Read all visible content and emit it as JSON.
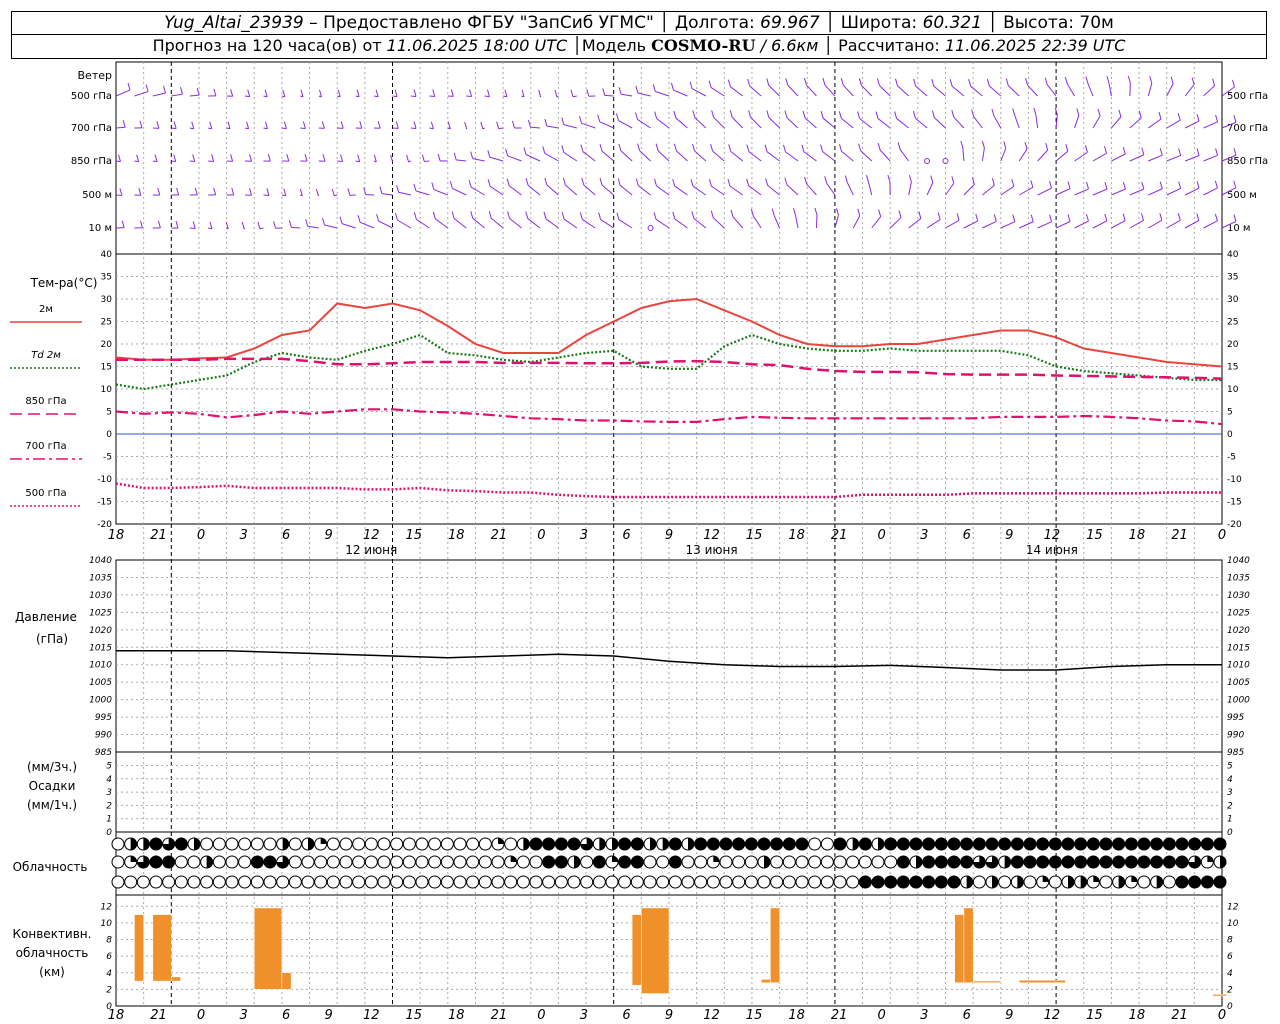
{
  "header": {
    "station": "Yug_Altai_23939",
    "provider": " – Предоставлено ФГБУ \"ЗапСиб УГМС\" ",
    "lon_label": "Долгота:",
    "lon": "69.967",
    "lat_label": "Широта:",
    "lat": "60.321",
    "alt_label": "Высота:",
    "alt": "70м",
    "forecast_label": "Прогноз на 120 часа(ов) от",
    "forecast_from": "11.06.2025 18:00 UTC",
    "model_label": "Модель",
    "model": "COSMO-RU",
    "model_res": " / 6.6км",
    "calc_label": "Рассчитано:",
    "calc_time": "11.06.2025 22:39 UTC"
  },
  "wind": {
    "title": "Ветер",
    "levels": [
      "500 гПа",
      "700 гПа",
      "850 гПа",
      "500 м",
      "10 м"
    ]
  },
  "temperature": {
    "title": "Тем-ра(°С)",
    "legend": [
      {
        "label": "2м",
        "color": "#e8453c",
        "style": "solid"
      },
      {
        "label": "Td  2м",
        "color": "#1a7a1a",
        "style": "dotted"
      },
      {
        "label": "850 гПа",
        "color": "#e0106f",
        "style": "dashed"
      },
      {
        "label": "700 гПа",
        "color": "#e0106f",
        "style": "dashdot"
      },
      {
        "label": "500 гПа",
        "color": "#e0106f",
        "style": "dotted"
      }
    ],
    "y_ticks": [
      "40",
      "35",
      "30",
      "25",
      "20",
      "15",
      "10",
      "5",
      "0",
      "-5",
      "-10",
      "-15",
      "-20"
    ]
  },
  "time_axis": {
    "hour_labels": [
      "18",
      "21",
      "0",
      "3",
      "6",
      "9",
      "12",
      "15",
      "18",
      "21",
      "0",
      "3",
      "6",
      "9",
      "12",
      "15",
      "18",
      "21",
      "0",
      "3",
      "6",
      "9",
      "12",
      "15",
      "18",
      "21",
      "0"
    ],
    "day_labels": [
      "12 июня",
      "13 июня",
      "14 июня"
    ]
  },
  "pressure": {
    "title": "Давление",
    "unit": "(гПа)",
    "y_ticks": [
      "1040",
      "1035",
      "1030",
      "1025",
      "1020",
      "1015",
      "1010",
      "1005",
      "1000",
      "995",
      "990",
      "985"
    ]
  },
  "precip": {
    "title1": "(мм/3ч.)",
    "title2": "Осадки",
    "title3": "(мм/1ч.)",
    "y_ticks": [
      "5",
      "4",
      "3",
      "2",
      "1",
      "0"
    ]
  },
  "clouds": {
    "title": "Облачность"
  },
  "convective": {
    "title1": "Конвективн.",
    "title2": "облачность",
    "title3": "(км)",
    "y_ticks": [
      "12",
      "10",
      "8",
      "6",
      "4",
      "2",
      "0"
    ]
  },
  "chart_data": [
    {
      "type": "line",
      "title": "Тем-ра(°С)",
      "x_unit": "hours from 11.06.2025 18:00 UTC",
      "ylim": [
        -20,
        40
      ],
      "x": [
        0,
        3,
        6,
        9,
        12,
        15,
        18,
        21,
        24,
        27,
        30,
        33,
        36,
        39,
        42,
        45,
        48,
        51,
        54,
        57,
        60,
        63,
        66,
        69,
        72,
        75,
        78,
        81,
        84,
        87,
        90,
        93,
        96,
        99,
        102,
        105,
        108,
        111,
        114,
        117,
        120
      ],
      "series": [
        {
          "name": "2м",
          "values": [
            17,
            16.5,
            16.5,
            16.8,
            17,
            19,
            22,
            23,
            29,
            28,
            29,
            27.5,
            24,
            20,
            18,
            18,
            18,
            22,
            25,
            28,
            29.5,
            30,
            27.5,
            25,
            22,
            20,
            19.5,
            19.5,
            20,
            20,
            21,
            22,
            23,
            23,
            21.5,
            19,
            18,
            17,
            16,
            15.5,
            15
          ]
        },
        {
          "name": "Td  2м",
          "values": [
            11,
            10,
            11,
            12,
            13,
            16,
            18,
            17,
            16.5,
            18.5,
            20,
            22,
            18,
            17.5,
            16.5,
            16,
            17,
            18,
            18.5,
            15,
            14.5,
            14.5,
            19.5,
            22,
            20,
            19,
            18.5,
            18.5,
            19,
            18.5,
            18.5,
            18.5,
            18.5,
            17.5,
            15,
            14,
            13.5,
            13,
            12.5,
            12,
            12
          ]
        },
        {
          "name": "850 гПа",
          "values": [
            16.5,
            16.5,
            16.5,
            16.5,
            16.7,
            16.7,
            16.7,
            16.2,
            15.5,
            15.5,
            15.7,
            16,
            16,
            16,
            15.8,
            15.8,
            15.8,
            15.7,
            15.7,
            15.8,
            16.1,
            16.2,
            16,
            15.5,
            15.3,
            14.5,
            14,
            13.8,
            13.8,
            13.7,
            13.3,
            13.2,
            13.2,
            13.2,
            13,
            12.9,
            12.8,
            12.7,
            12.6,
            12.5,
            12.3
          ]
        },
        {
          "name": "700 гПа",
          "values": [
            5,
            4.5,
            4.8,
            4.5,
            3.7,
            4.2,
            5,
            4.5,
            5,
            5.5,
            5.5,
            5,
            4.8,
            4.5,
            4,
            3.5,
            3.3,
            3,
            3,
            2.8,
            2.7,
            2.7,
            3.3,
            3.8,
            3.6,
            3.5,
            3.5,
            3.5,
            3.5,
            3.5,
            3.5,
            3.5,
            3.8,
            3.8,
            3.8,
            4,
            3.8,
            3.5,
            3,
            2.8,
            2.2
          ]
        },
        {
          "name": "500 гПа",
          "values": [
            -11,
            -12,
            -12,
            -11.8,
            -11.5,
            -12,
            -12,
            -12,
            -12,
            -12.3,
            -12.3,
            -12,
            -12.5,
            -12.7,
            -13,
            -13,
            -13.5,
            -13.8,
            -14,
            -14,
            -14,
            -14,
            -14,
            -14,
            -14,
            -14,
            -14,
            -13.5,
            -13.5,
            -13.5,
            -13.5,
            -13.2,
            -13.2,
            -13.2,
            -13.2,
            -13.2,
            -13.2,
            -13.2,
            -13,
            -13,
            -13
          ]
        }
      ]
    },
    {
      "type": "line",
      "title": "Давление (гПа)",
      "ylim": [
        985,
        1040
      ],
      "x": [
        0,
        6,
        12,
        18,
        24,
        30,
        36,
        42,
        48,
        54,
        60,
        66,
        72,
        78,
        84,
        90,
        96,
        102,
        108,
        114,
        120
      ],
      "series": [
        {
          "name": "",
          "values": [
            1014,
            1014,
            1014,
            1013.5,
            1013,
            1012.5,
            1012,
            1012.5,
            1013,
            1012.5,
            1011,
            1010,
            1009.5,
            1009.5,
            1009.8,
            1009.2,
            1008.5,
            1008.5,
            1009.5,
            1010,
            1010
          ]
        }
      ]
    },
    {
      "type": "bar",
      "title": "Конвективн. облачность (км)",
      "ylim": [
        0,
        12
      ],
      "bars": [
        {
          "x0": 2,
          "x1": 3,
          "bottom": 3,
          "top": 11
        },
        {
          "x0": 4,
          "x1": 6,
          "bottom": 3,
          "top": 11
        },
        {
          "x0": 6,
          "x1": 7,
          "bottom": 3,
          "top": 3.5
        },
        {
          "x0": 15,
          "x1": 18,
          "bottom": 2,
          "top": 11.8
        },
        {
          "x0": 18,
          "x1": 19,
          "bottom": 2,
          "top": 4
        },
        {
          "x0": 56,
          "x1": 57,
          "bottom": 2.5,
          "top": 11
        },
        {
          "x0": 57,
          "x1": 60,
          "bottom": 1.5,
          "top": 11.8
        },
        {
          "x0": 70,
          "x1": 71,
          "bottom": 2.8,
          "top": 3.2
        },
        {
          "x0": 71,
          "x1": 72,
          "bottom": 2.8,
          "top": 11.8
        },
        {
          "x0": 91,
          "x1": 92,
          "bottom": 2.8,
          "top": 11
        },
        {
          "x0": 92,
          "x1": 93,
          "bottom": 2.8,
          "top": 11.8
        },
        {
          "x0": 93,
          "x1": 96,
          "bottom": 2.8,
          "top": 3.0
        },
        {
          "x0": 98,
          "x1": 103,
          "bottom": 2.8,
          "top": 3.1
        },
        {
          "x0": 119,
          "x1": 120.5,
          "bottom": 1.2,
          "top": 1.4
        }
      ]
    }
  ],
  "colors": {
    "wind": "#8a2be2",
    "t2m": "#e8453c",
    "td": "#1a7a1a",
    "upper": "#e0106f",
    "pressure": "#000000",
    "convective": "#f0902a",
    "zero_line": "#3050d0"
  }
}
